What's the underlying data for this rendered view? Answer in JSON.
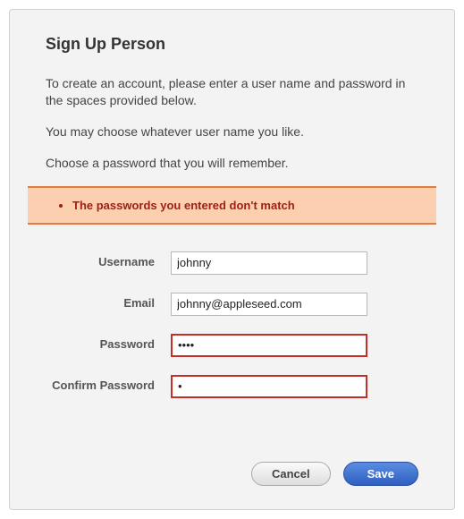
{
  "title": "Sign Up Person",
  "intro": {
    "p1": "To create an account, please enter a user name and password in the spaces provided below.",
    "p2": "You may choose whatever user name you like.",
    "p3": "Choose a password that you will remember."
  },
  "error": {
    "message": "The passwords you entered don't match"
  },
  "form": {
    "username": {
      "label": "Username",
      "value": "johnny"
    },
    "email": {
      "label": "Email",
      "value": "johnny@appleseed.com"
    },
    "password": {
      "label": "Password",
      "value": "••••"
    },
    "confirm_password": {
      "label": "Confirm Password",
      "value": "•"
    }
  },
  "buttons": {
    "cancel": "Cancel",
    "save": "Save"
  },
  "colors": {
    "error_bg": "#fccfb1",
    "error_border": "#e27c3d",
    "error_text": "#9e1f17",
    "input_error_border": "#c43028",
    "save_btn": "#2f5fc2"
  }
}
